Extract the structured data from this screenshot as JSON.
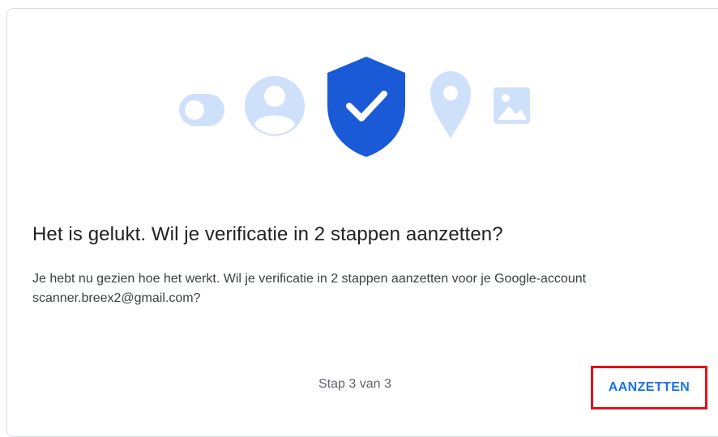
{
  "dialog": {
    "title": "Het is gelukt. Wil je verificatie in 2 stappen aanzetten?",
    "description": "Je hebt nu gezien hoe het werkt. Wil je verificatie in 2 stappen aanzetten voor je Google-account scanner.breex2@gmail.com?",
    "step_indicator": "Stap 3 van 3",
    "primary_action_label": "AANZETTEN"
  },
  "illustration": {
    "icons": [
      "toggle-icon",
      "account-icon",
      "shield-check-icon",
      "location-pin-icon",
      "image-icon"
    ]
  },
  "colors": {
    "accent": "#1a73e8",
    "shield": "#1a5ad7",
    "icon_light": "#cfe0fb",
    "highlight": "#e0121a",
    "title_text": "#202124",
    "body_text": "#3c4043",
    "muted_text": "#5f6368",
    "border": "#dadce0"
  }
}
